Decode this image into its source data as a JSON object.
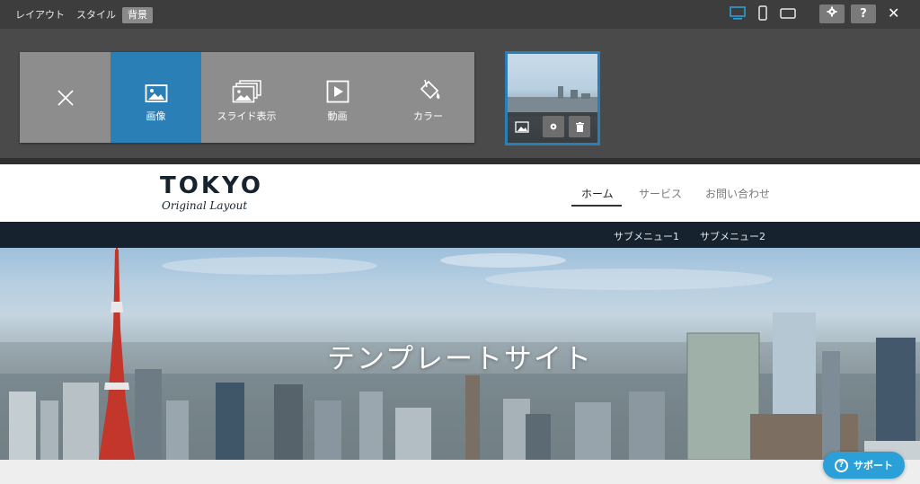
{
  "toolbar": {
    "tabs": [
      {
        "label": "レイアウト",
        "active": false
      },
      {
        "label": "スタイル",
        "active": false
      },
      {
        "label": "背景",
        "active": true
      }
    ],
    "device_icons": [
      "desktop-icon",
      "mobile-icon",
      "tablet-icon"
    ],
    "settings_icon": "gear-icon",
    "help_label": "?",
    "close_label": "✕"
  },
  "background_menu": {
    "close_icon": "close-icon",
    "options": [
      {
        "label": "画像",
        "icon": "image-icon",
        "selected": true
      },
      {
        "label": "スライド表示",
        "icon": "slides-icon",
        "selected": false
      },
      {
        "label": "動画",
        "icon": "video-icon",
        "selected": false
      },
      {
        "label": "カラー",
        "icon": "paint-bucket-icon",
        "selected": false
      }
    ],
    "thumbnail_actions": [
      "image-icon",
      "gear-icon",
      "trash-icon"
    ]
  },
  "site": {
    "logo_main": "TOKYO",
    "logo_sub": "Original Layout",
    "nav": [
      {
        "label": "ホーム",
        "active": true
      },
      {
        "label": "サービス",
        "active": false
      },
      {
        "label": "お問い合わせ",
        "active": false
      }
    ],
    "subnav": [
      "サブメニュー1",
      "サブメニュー2"
    ],
    "hero_title": "テンプレートサイト"
  },
  "support_button": {
    "label": "サポート",
    "icon": "question-circle-icon"
  },
  "colors": {
    "accent": "#2a7fb6",
    "header_dark": "#16232e",
    "support": "#2a9fd8"
  }
}
